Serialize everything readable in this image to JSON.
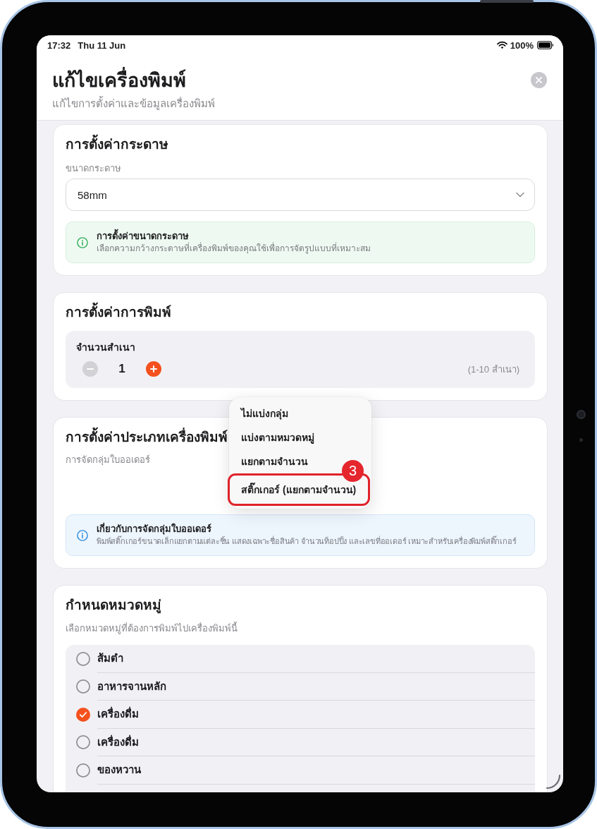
{
  "status_bar": {
    "time": "17:32",
    "date": "Thu 11 Jun",
    "battery": "100%"
  },
  "header": {
    "title": "แก้ไขเครื่องพิมพ์",
    "subtitle": "แก้ไขการตั้งค่าและข้อมูลเครื่องพิมพ์"
  },
  "paper_settings": {
    "title": "การตั้งค่ากระดาษ",
    "paper_size": {
      "label": "ขนาดกระดาษ",
      "value": "58mm"
    },
    "info": {
      "kind": "success",
      "title": "การตั้งค่าขนาดกระดาษ",
      "text": "เลือกความกว้างกระดาษที่เครื่องพิมพ์ของคุณใช้เพื่อการจัดรูปแบบที่เหมาะสม"
    }
  },
  "print_settings": {
    "title": "การตั้งค่าการพิมพ์",
    "copies": {
      "label": "จำนวนสำเนา",
      "value": "1",
      "range": "(1-10 สำเนา)",
      "decrement_disabled": true,
      "increment_disabled": false
    }
  },
  "printer_type": {
    "title": "การตั้งค่าประเภทเครื่องพิมพ์",
    "grouping_label": "การจัดกลุ่มใบออเดอร์",
    "info": {
      "kind": "info",
      "title": "เกี่ยวกับการจัดกลุ่มใบออเดอร์",
      "text": "พิมพ์สติ๊กเกอร์ขนาดเล็กแยกตามแต่ละชิ้น แสดงเฉพาะชื่อสินค้า จำนวนท็อปปิ้ง และเลขที่ออเดอร์ เหมาะสำหรับเครื่องพิมพ์สติ๊กเกอร์"
    }
  },
  "grouping_menu": {
    "options": [
      {
        "label": "ไม่แบ่งกลุ่ม",
        "highlighted": false
      },
      {
        "label": "แบ่งตามหมวดหมู่",
        "highlighted": false
      },
      {
        "label": "แยกตามจำนวน",
        "highlighted": false
      },
      {
        "label": "สติ๊กเกอร์ (แยกตามจำนวน)",
        "highlighted": true
      }
    ],
    "callout_number": "3"
  },
  "categories": {
    "title": "กำหนดหมวดหมู่",
    "subtitle": "เลือกหมวดหมู่ที่ต้องการพิมพ์ไปเครื่องพิมพ์นี้",
    "items": [
      {
        "label": "ส้มตำ",
        "checked": false
      },
      {
        "label": "อาหารจานหลัก",
        "checked": false
      },
      {
        "label": "เครื่องดื่ม",
        "checked": true
      },
      {
        "label": "เครื่องดื่ม",
        "checked": false
      },
      {
        "label": "ของหวาน",
        "checked": false
      }
    ]
  }
}
